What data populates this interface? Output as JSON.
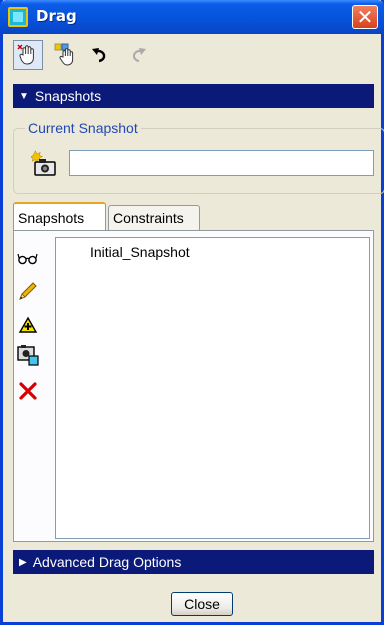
{
  "window": {
    "title": "Drag",
    "close_glyph": "✕"
  },
  "toolbar": {
    "items": [
      {
        "icon": "drag-hand-icon",
        "pressed": true
      },
      {
        "icon": "multi-drag-hand-icon",
        "pressed": false
      },
      {
        "icon": "undo-icon",
        "pressed": false
      },
      {
        "icon": "redo-icon",
        "pressed": false,
        "disabled": true
      }
    ]
  },
  "snapshots_section": {
    "label": "Snapshots",
    "expanded": true
  },
  "current_snapshot": {
    "group_label": "Current Snapshot",
    "value": ""
  },
  "tabs": [
    {
      "label": "Snapshots",
      "active": true
    },
    {
      "label": "Constraints",
      "active": false
    }
  ],
  "side_tools": [
    "show-snapshot-icon",
    "edit-pencil-icon",
    "warning-add-icon",
    "camera-copy-icon",
    "delete-x-icon"
  ],
  "snapshot_list": [
    "Initial_Snapshot"
  ],
  "advanced_section": {
    "label": "Advanced Drag Options",
    "expanded": false
  },
  "footer": {
    "close_label": "Close"
  },
  "colors": {
    "header_bar": "#0b1a78",
    "window_bg": "#ece9d8",
    "group_label": "#2148b4"
  }
}
